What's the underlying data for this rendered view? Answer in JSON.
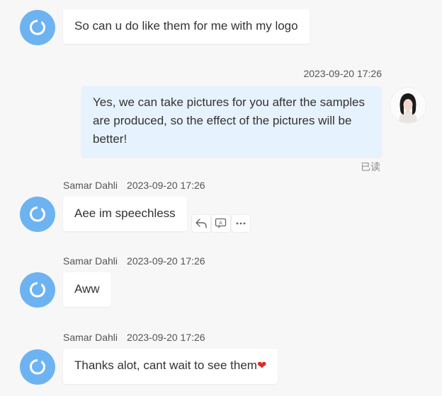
{
  "messages": [
    {
      "direction": "incoming",
      "sender": "",
      "time": "",
      "text": "So can u do like them for me with my logo"
    },
    {
      "direction": "outgoing",
      "time": "2023-09-20 17:26",
      "text": "Yes, we can take pictures for you after the samples are produced, so the effect of the pictures will be better!",
      "read_status": "已读"
    },
    {
      "direction": "incoming",
      "sender": "Samar Dahli",
      "time": "2023-09-20 17:26",
      "text": "Aee im speechless",
      "actions": [
        "reply-icon",
        "translate-icon",
        "more-icon"
      ]
    },
    {
      "direction": "incoming",
      "sender": "Samar Dahli",
      "time": "2023-09-20 17:26",
      "text": "Aww"
    },
    {
      "direction": "incoming",
      "sender": "Samar Dahli",
      "time": "2023-09-20 17:26",
      "text": "Thanks alot, cant wait to see them",
      "emoji": "❤"
    }
  ],
  "colors": {
    "background": "#f7f7f7",
    "incoming_bubble": "#ffffff",
    "outgoing_bubble": "#e6f2fd",
    "avatar_blue": "#6db3f2",
    "heart": "#e02b2b"
  }
}
